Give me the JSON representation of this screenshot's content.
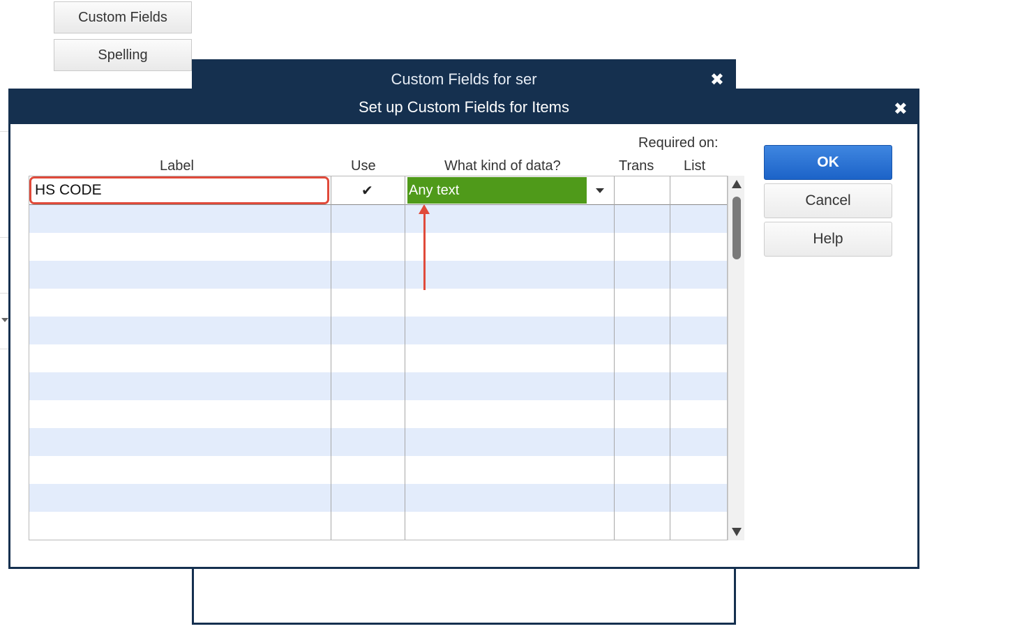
{
  "background": {
    "side_buttons": [
      "Custom Fields",
      "Spelling"
    ],
    "back_dialog_title": "Custom Fields for ser"
  },
  "dialog": {
    "title": "Set up Custom Fields for Items",
    "close_glyph": "✖"
  },
  "table": {
    "headers": {
      "label": "Label",
      "use": "Use",
      "kind": "What kind of data?",
      "required_on": "Required on:",
      "trans": "Trans",
      "list": "List"
    },
    "first_row": {
      "label": "HS CODE",
      "use": "✔",
      "kind": "Any text"
    }
  },
  "buttons": {
    "ok": "OK",
    "cancel": "Cancel",
    "help": "Help"
  },
  "colors": {
    "title_bar": "#15304f",
    "ok_button": "#1c63c8",
    "selected_kind": "#4f9a1a",
    "annotation": "#e04a3a",
    "alt_row": "#e3ecfb"
  }
}
